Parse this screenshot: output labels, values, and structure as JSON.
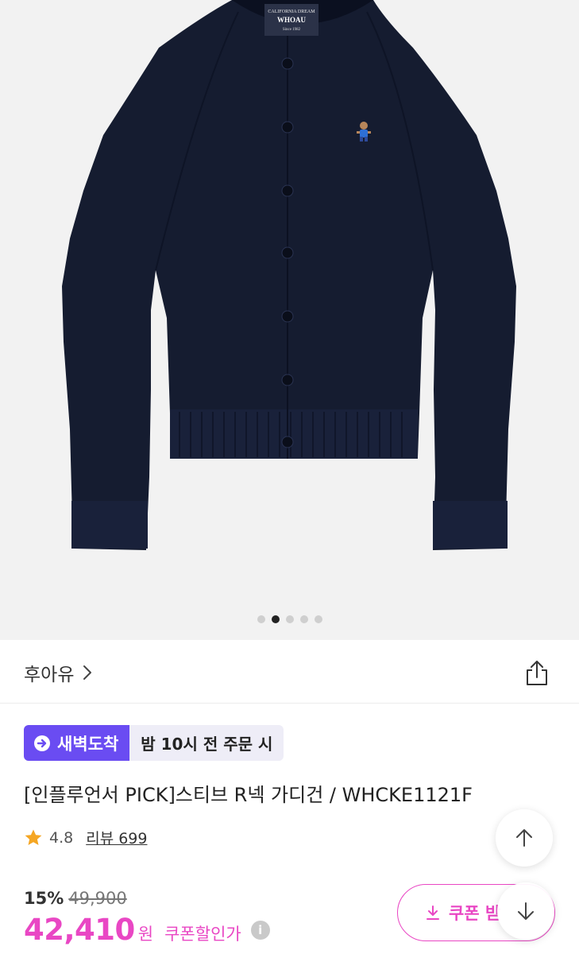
{
  "hero": {
    "label_lines": [
      "CALIFORNIA DREAM",
      "WHOAU",
      "Since 1982"
    ],
    "carousel": {
      "total": 5,
      "active": 2
    }
  },
  "brand": {
    "name": "후아유",
    "chevron_icon": "chevron-right-icon",
    "share_icon": "share-icon"
  },
  "badges": {
    "delivery": "새벽도착",
    "delivery_icon": "arrow-circle-icon",
    "condition": "밤 10시 전 주문 시"
  },
  "product": {
    "title": "[인플루언서 PICK]스티브 R넥 가디건 / WHCKE1121F"
  },
  "rating": {
    "star_icon": "star-icon",
    "value": "4.8",
    "reviews_label": "리뷰 699"
  },
  "price": {
    "discount": "15%",
    "original": "49,900",
    "sale": "42,410",
    "currency": "원",
    "coupon_label": "쿠폰할인가",
    "info_icon": "i"
  },
  "coupon_button": {
    "label": "쿠폰 받",
    "icon": "download-icon"
  },
  "fab": {
    "up_icon": "arrow-up-icon",
    "down_icon": "arrow-down-icon"
  },
  "colors": {
    "accent": "#e947c4",
    "badge": "#6a4cf2",
    "star": "#f5a623",
    "garment": "#151c30"
  }
}
